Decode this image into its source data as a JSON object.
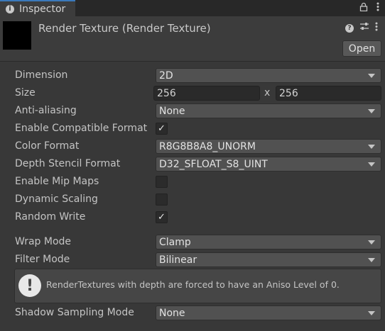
{
  "tab": {
    "title": "Inspector",
    "icon": "info-icon"
  },
  "header": {
    "title": "Render Texture (Render Texture)",
    "open_label": "Open"
  },
  "fields": {
    "dimension": {
      "label": "Dimension",
      "value": "2D"
    },
    "size": {
      "label": "Size",
      "width": "256",
      "x": "x",
      "height": "256"
    },
    "anti_aliasing": {
      "label": "Anti-aliasing",
      "value": "None"
    },
    "compatible": {
      "label": "Enable Compatible Format",
      "checked": true
    },
    "color_format": {
      "label": "Color Format",
      "value": "R8G8B8A8_UNORM"
    },
    "depth_stencil": {
      "label": "Depth Stencil Format",
      "value": "D32_SFLOAT_S8_UINT"
    },
    "mip_maps": {
      "label": "Enable Mip Maps",
      "checked": false
    },
    "dynamic_scaling": {
      "label": "Dynamic Scaling",
      "checked": false
    },
    "random_write": {
      "label": "Random Write",
      "checked": true
    },
    "wrap_mode": {
      "label": "Wrap Mode",
      "value": "Clamp"
    },
    "filter_mode": {
      "label": "Filter Mode",
      "value": "Bilinear"
    },
    "shadow_sampling": {
      "label": "Shadow Sampling Mode",
      "value": "None"
    }
  },
  "help_box": {
    "text": "RenderTextures with depth are forced to have an Aniso Level of 0."
  },
  "check_mark": "✓"
}
